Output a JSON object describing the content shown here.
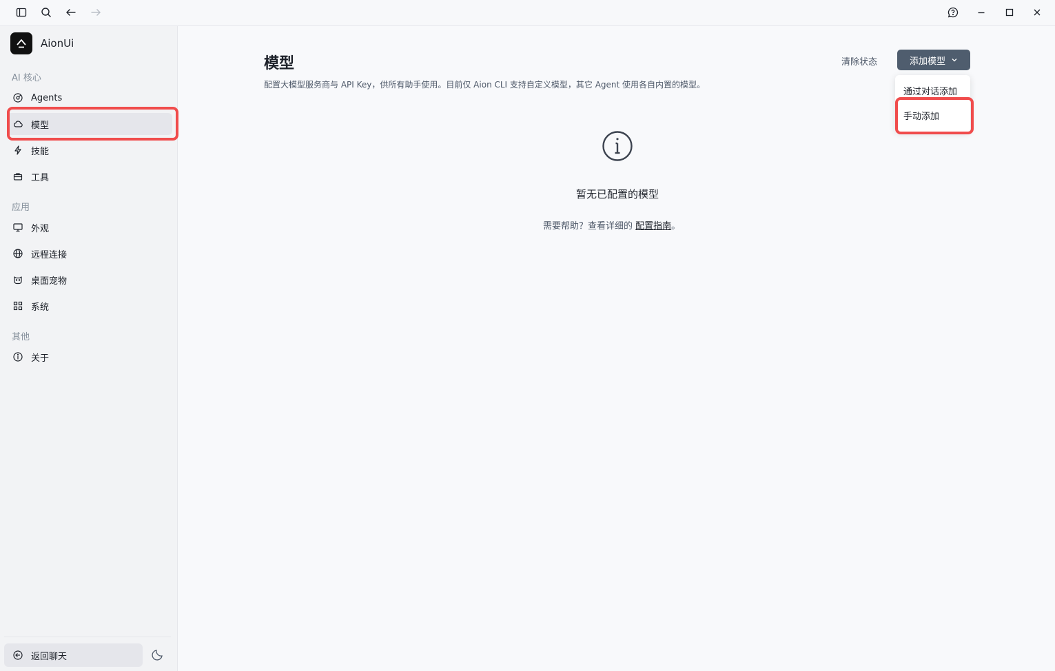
{
  "brand": {
    "name": "AionUi"
  },
  "sidebar": {
    "sections": [
      {
        "label": "AI 核心"
      },
      {
        "label": "应用"
      },
      {
        "label": "其他"
      }
    ],
    "items": [
      {
        "label": "Agents",
        "icon": "target-icon"
      },
      {
        "label": "模型",
        "icon": "cloud-icon",
        "active": true
      },
      {
        "label": "技能",
        "icon": "lightning-icon"
      },
      {
        "label": "工具",
        "icon": "toolbox-icon"
      },
      {
        "label": "外观",
        "icon": "monitor-icon"
      },
      {
        "label": "远程连接",
        "icon": "globe-icon"
      },
      {
        "label": "桌面宠物",
        "icon": "pet-icon"
      },
      {
        "label": "系统",
        "icon": "grid-icon"
      },
      {
        "label": "关于",
        "icon": "info-icon"
      }
    ],
    "back_label": "返回聊天"
  },
  "main": {
    "title": "模型",
    "description": "配置大模型服务商与 API Key，供所有助手使用。目前仅 Aion CLI 支持自定义模型，其它 Agent 使用各自内置的模型。",
    "clear_status": "清除状态",
    "add_model": "添加模型",
    "dropdown": {
      "items": [
        {
          "label": "通过对话添加"
        },
        {
          "label": "手动添加"
        }
      ]
    },
    "empty": {
      "title": "暂无已配置的模型",
      "help_prefix": "需要帮助？查看详细的 ",
      "help_link": "配置指南",
      "help_suffix": "。"
    }
  },
  "colors": {
    "highlight": "#f04c4c",
    "primary_button": "#4f5d6e"
  }
}
